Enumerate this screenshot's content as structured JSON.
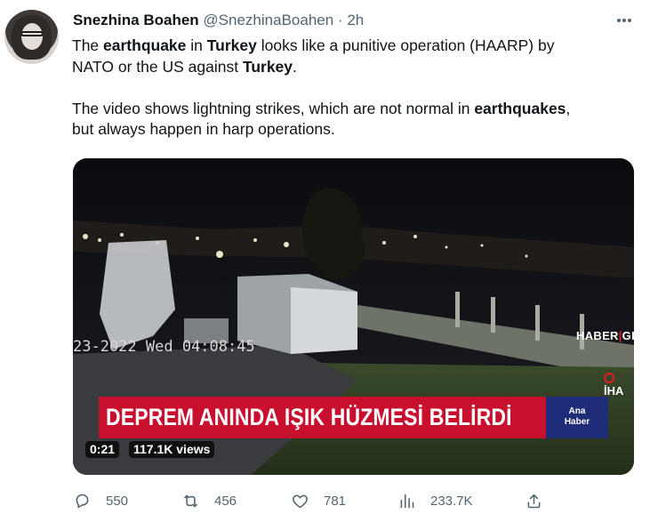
{
  "author": {
    "name": "Snezhina Boahen",
    "handle": "@SnezhinaBoahen",
    "separator": "·",
    "time": "2h"
  },
  "tweet": {
    "line1": [
      {
        "t": "The ",
        "b": false
      },
      {
        "t": "earthquake",
        "b": true
      },
      {
        "t": " in ",
        "b": false
      },
      {
        "t": "Turkey",
        "b": true
      },
      {
        "t": " looks like a punitive operation (HAARP) by",
        "b": false
      }
    ],
    "line2": [
      {
        "t": "NATO or the US against ",
        "b": false
      },
      {
        "t": "Turkey",
        "b": true
      },
      {
        "t": ".",
        "b": false
      }
    ],
    "line3": [
      {
        "t": " The video shows lightning strikes, which are not normal in ",
        "b": false
      },
      {
        "t": "earthquakes",
        "b": true
      },
      {
        "t": ",",
        "b": false
      }
    ],
    "line4": [
      {
        "t": "but always happen in harp operations.",
        "b": false
      }
    ]
  },
  "video": {
    "timestamp": "23-2022 Wed 04:08:45",
    "broadcaster_left": "HABER",
    "broadcaster_sep": "|",
    "broadcaster_right": "GLOBAL",
    "agency": "İHA",
    "headline": "DEPREM ANINDA IŞIK HÜZMESİ BELİRDİ",
    "side_label_1": "Ana",
    "side_label_2": "Haber",
    "duration": "0:21",
    "views": "117.1K views"
  },
  "actions": {
    "replies": "550",
    "retweets": "456",
    "likes": "781",
    "views": "233.7K"
  },
  "icons": {
    "reply": "reply-icon",
    "retweet": "retweet-icon",
    "like": "heart-icon",
    "views": "analytics-icon",
    "share": "share-icon",
    "more": "more-icon"
  },
  "colors": {
    "text": "#0f1419",
    "muted": "#536471",
    "banner_red": "#c8102e",
    "banner_blue": "#1f2c77"
  }
}
